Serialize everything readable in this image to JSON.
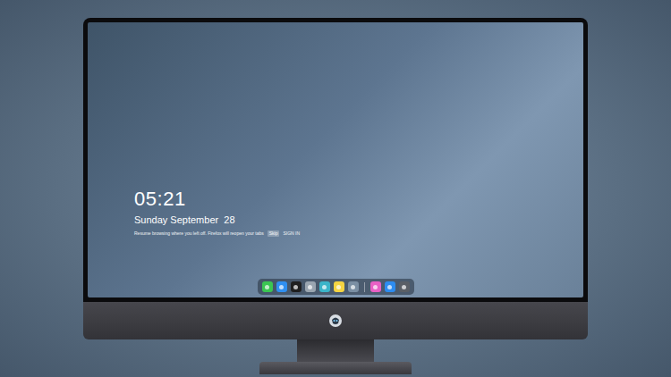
{
  "lock_screen": {
    "time": "05:21",
    "date": "Sunday September  28",
    "notice": "Resume browsing where you left off. Firefox will reopen your tabs",
    "notice_actions": [
      "Skip",
      "SIGN IN"
    ]
  },
  "dock": {
    "apps": [
      {
        "color": "#3bc552"
      },
      {
        "color": "#2f8ff0"
      },
      {
        "color": "#1f1f1f"
      },
      {
        "color": "#9aa5b0"
      },
      {
        "color": "#3bb4c9"
      },
      {
        "color": "#f5d442"
      },
      {
        "color": "#7b8fa3"
      }
    ],
    "pinned": [
      {
        "color": "#e861c5"
      },
      {
        "color": "#2d8cf0"
      },
      {
        "color": "#5a5f66"
      }
    ]
  }
}
